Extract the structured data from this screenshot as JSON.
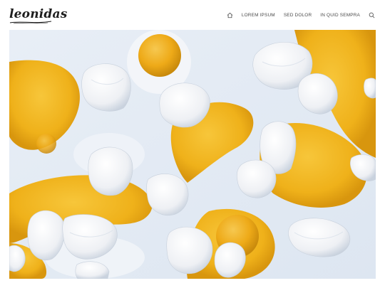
{
  "site": {
    "logo_text": "leonidas"
  },
  "nav": {
    "items": [
      {
        "label": "LOREM IPSUM"
      },
      {
        "label": "SED DOLOR"
      },
      {
        "label": "IN QUID SEMPRA"
      }
    ],
    "home_icon": "home-icon",
    "search_icon": "search-icon"
  },
  "hero": {
    "subject": "cracked eggshells and yolks",
    "colors": {
      "background": "#e4ecf5",
      "yolk": "#f2b51c",
      "yolk_dark": "#d89810",
      "shell": "#f6f6f8",
      "shadow": "#b9c6d8"
    }
  }
}
